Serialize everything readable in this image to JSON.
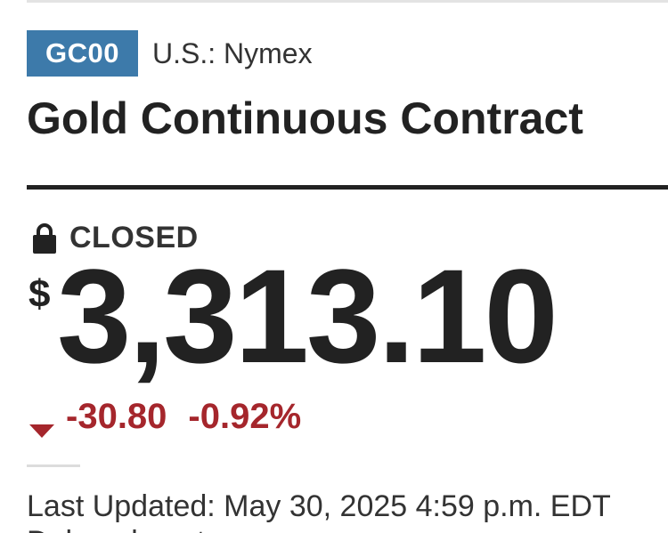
{
  "quote": {
    "ticker": "GC00",
    "exchange": "U.S.: Nymex",
    "title": "Gold Continuous Contract",
    "status": "CLOSED",
    "status_icon": "lock-icon",
    "currency_symbol": "$",
    "price": "3,313.10",
    "change": "-30.80",
    "change_percent": "-0.92%",
    "change_direction": "down",
    "last_updated": "Last Updated: May 30, 2025 4:59 p.m. EDT",
    "next_line_partial": "Delayed quote"
  },
  "colors": {
    "badge": "#3d7aaa",
    "negative": "#a5262c",
    "text": "#222222"
  }
}
